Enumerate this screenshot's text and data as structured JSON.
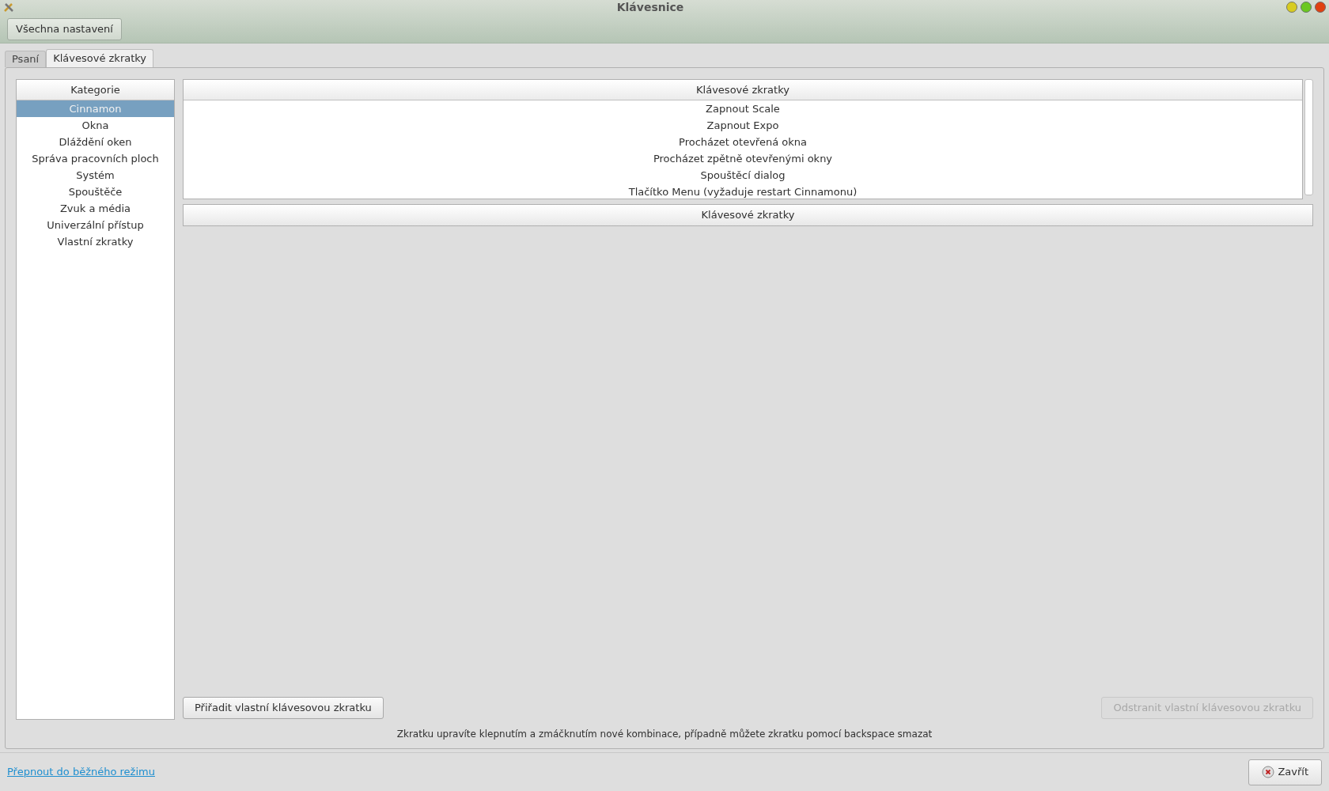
{
  "window": {
    "title": "Klávesnice"
  },
  "header": {
    "back_button": "Všechna nastavení"
  },
  "tabs": [
    {
      "label": "Psaní",
      "selected": false
    },
    {
      "label": "Klávesové zkratky",
      "selected": true
    }
  ],
  "categories": {
    "heading": "Kategorie",
    "items": [
      {
        "label": "Cinnamon",
        "selected": true
      },
      {
        "label": "Okna",
        "selected": false
      },
      {
        "label": "Dláždění oken",
        "selected": false
      },
      {
        "label": "Správa pracovních ploch",
        "selected": false
      },
      {
        "label": "Systém",
        "selected": false
      },
      {
        "label": "Spouštěče",
        "selected": false
      },
      {
        "label": "Zvuk a média",
        "selected": false
      },
      {
        "label": "Univerzální přístup",
        "selected": false
      },
      {
        "label": "Vlastní zkratky",
        "selected": false
      }
    ]
  },
  "shortcuts": {
    "heading": "Klávesové zkratky",
    "rows": [
      "Zapnout Scale",
      "Zapnout Expo",
      "Procházet otevřená okna",
      "Procházet zpětně otevřenými okny",
      "Spouštěcí dialog",
      "Tlačítko Menu (vyžaduje restart Cinnamonu)"
    ]
  },
  "bindings": {
    "heading": "Klávesové zkratky"
  },
  "buttons": [
    {
      "label": "Přiřadit vlastní klávesovou zkratku",
      "disabled": false
    },
    {
      "label": "Odstranit vlastní klávesovou zkratku",
      "disabled": true
    }
  ],
  "hint": "Zkratku upravíte klepnutím a zmáčknutím nové kombinace, případně můžete zkratku pomocí backspace smazat",
  "footer": {
    "link": "Přepnout do běžného režimu",
    "close_button": "Zavřít"
  }
}
